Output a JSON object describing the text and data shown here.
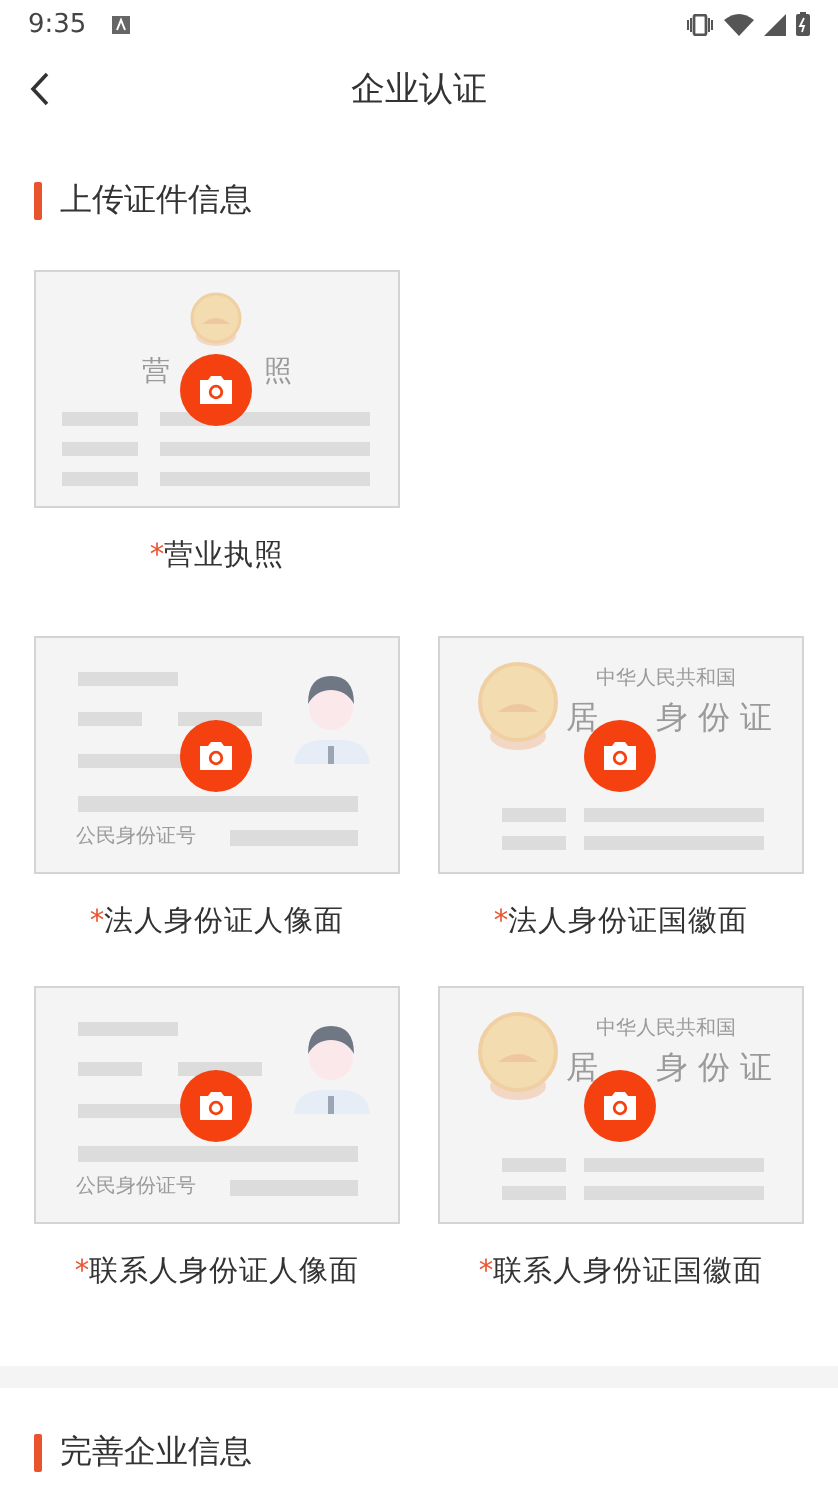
{
  "status_bar": {
    "time": "9:35"
  },
  "nav": {
    "title": "企业认证"
  },
  "upload_section": {
    "title": "上传证件信息",
    "uploads": [
      {
        "kind": "license",
        "required_mark": "*",
        "label": "营业执照",
        "card_texts": [
          "营",
          "照"
        ]
      },
      {
        "kind": "id_front",
        "required_mark": "*",
        "label": "法人身份证人像面",
        "card_texts": [
          "公民身份证号"
        ]
      },
      {
        "kind": "id_back",
        "required_mark": "*",
        "label": "法人身份证国徽面",
        "card_texts": [
          "中华人民共和国",
          "居",
          "身 份 证"
        ]
      },
      {
        "kind": "id_front",
        "required_mark": "*",
        "label": "联系人身份证人像面",
        "card_texts": [
          "公民身份证号"
        ]
      },
      {
        "kind": "id_back",
        "required_mark": "*",
        "label": "联系人身份证国徽面",
        "card_texts": [
          "中华人民共和国",
          "居",
          "身 份 证"
        ]
      }
    ]
  },
  "info_section": {
    "title": "完善企业信息"
  }
}
